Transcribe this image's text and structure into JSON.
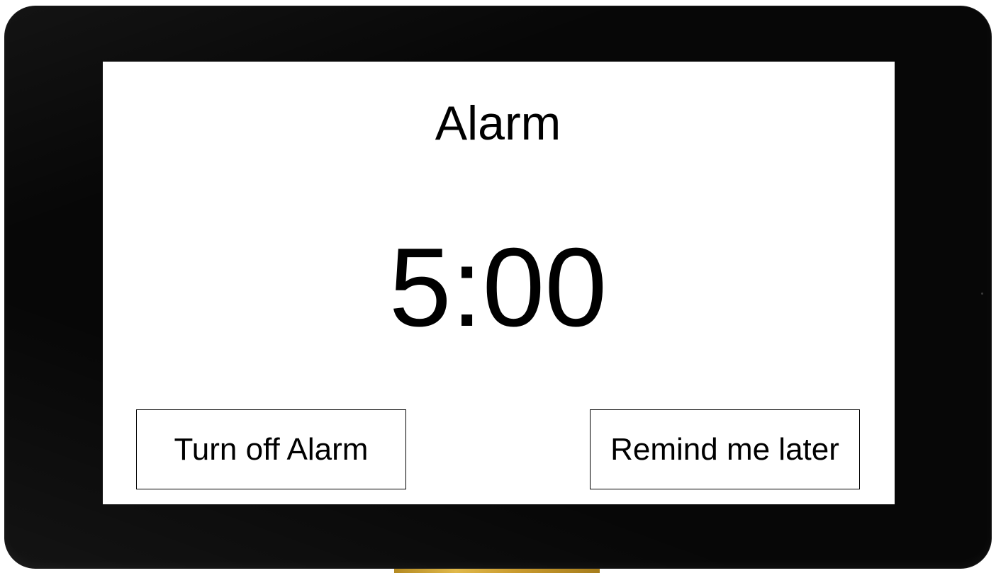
{
  "alarm": {
    "title": "Alarm",
    "time": "5:00"
  },
  "actions": {
    "turn_off_label": "Turn off Alarm",
    "remind_later_label": "Remind me later"
  },
  "colors": {
    "bezel": "#070707",
    "screen_background": "#ffffff",
    "text": "#000000",
    "button_border": "#000000"
  }
}
